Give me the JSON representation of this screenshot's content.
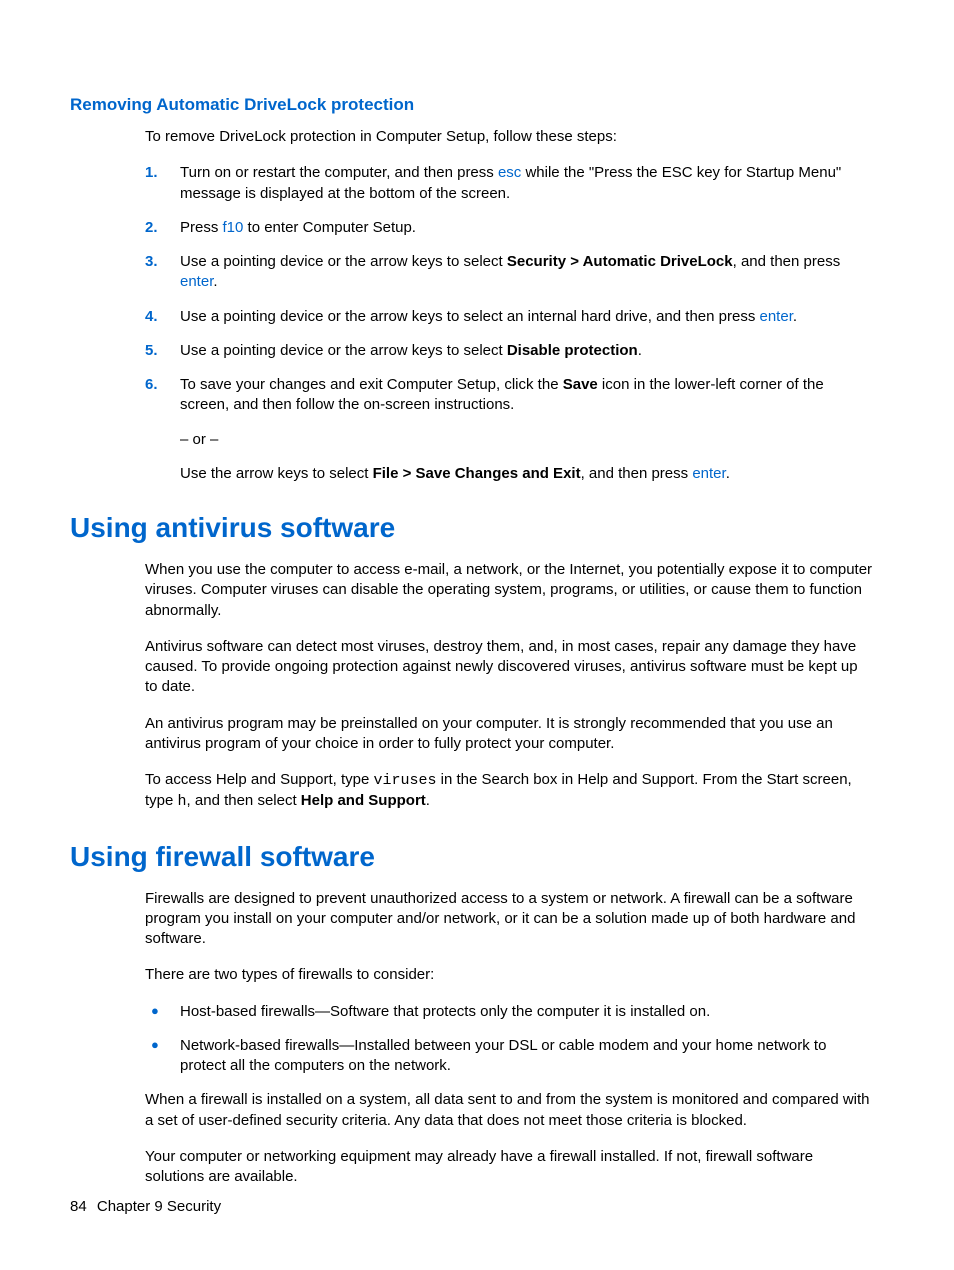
{
  "subsection1": {
    "title": "Removing Automatic DriveLock protection",
    "intro": "To remove DriveLock protection in Computer Setup, follow these steps:",
    "steps": [
      {
        "num": "1.",
        "pre": "Turn on or restart the computer, and then press ",
        "key": "esc",
        "post": " while the \"Press the ESC key for Startup Menu\" message is displayed at the bottom of the screen."
      },
      {
        "num": "2.",
        "pre": "Press ",
        "key": "f10",
        "post": " to enter Computer Setup."
      },
      {
        "num": "3.",
        "pre": "Use a pointing device or the arrow keys to select ",
        "bold": "Security > Automatic DriveLock",
        "mid": ", and then press ",
        "key": "enter",
        "post": "."
      },
      {
        "num": "4.",
        "pre": "Use a pointing device or the arrow keys to select an internal hard drive, and then press ",
        "key": "enter",
        "post": "."
      },
      {
        "num": "5.",
        "pre": "Use a pointing device or the arrow keys to select ",
        "bold": "Disable protection",
        "post": "."
      },
      {
        "num": "6.",
        "pre": "To save your changes and exit Computer Setup, click the ",
        "bold": "Save",
        "post": " icon in the lower-left corner of the screen, and then follow the on-screen instructions."
      }
    ],
    "orText": "– or –",
    "orLine": {
      "pre": "Use the arrow keys to select ",
      "bold": "File > Save Changes and Exit",
      "mid": ", and then press ",
      "key": "enter",
      "post": "."
    }
  },
  "section2": {
    "title": "Using antivirus software",
    "p1": "When you use the computer to access e-mail, a network, or the Internet, you potentially expose it to computer viruses. Computer viruses can disable the operating system, programs, or utilities, or cause them to function abnormally.",
    "p2": "Antivirus software can detect most viruses, destroy them, and, in most cases, repair any damage they have caused. To provide ongoing protection against newly discovered viruses, antivirus software must be kept up to date.",
    "p3": "An antivirus program may be preinstalled on your computer. It is strongly recommended that you use an antivirus program of your choice in order to fully protect your computer.",
    "p4": {
      "pre": "To access Help and Support, type ",
      "mono1": "viruses",
      "mid1": " in the Search box in Help and Support. From the Start screen, type ",
      "mono2": "h",
      "mid2": ", and then select ",
      "bold": "Help and Support",
      "post": "."
    }
  },
  "section3": {
    "title": "Using firewall software",
    "p1": "Firewalls are designed to prevent unauthorized access to a system or network. A firewall can be a software program you install on your computer and/or network, or it can be a solution made up of both hardware and software.",
    "p2": "There are two types of firewalls to consider:",
    "bullets": [
      "Host-based firewalls—Software that protects only the computer it is installed on.",
      "Network-based firewalls—Installed between your DSL or cable modem and your home network to protect all the computers on the network."
    ],
    "p3": "When a firewall is installed on a system, all data sent to and from the system is monitored and compared with a set of user-defined security criteria. Any data that does not meet those criteria is blocked.",
    "p4": "Your computer or networking equipment may already have a firewall installed. If not, firewall software solutions are available."
  },
  "footer": {
    "pageNum": "84",
    "chapter": "Chapter 9   Security"
  },
  "bulletChar": "●"
}
